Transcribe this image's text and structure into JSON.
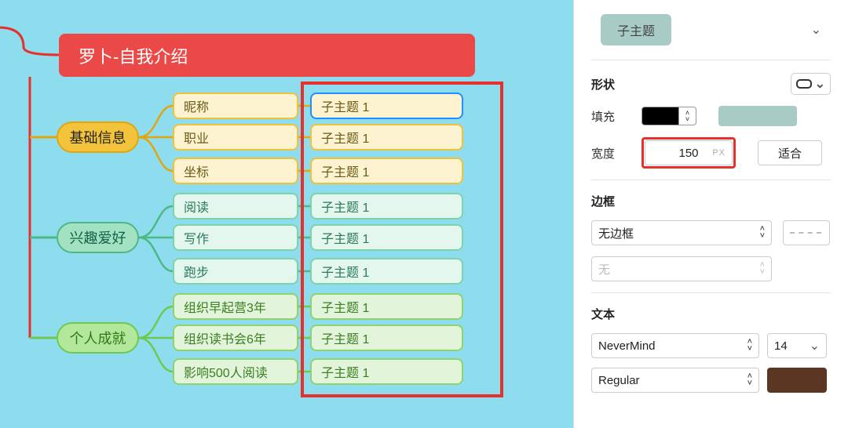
{
  "mindmap": {
    "root": "罗卜-自我介绍",
    "branches": [
      {
        "label": "基础信息",
        "subs": [
          "昵称",
          "职业",
          "坐标"
        ],
        "leaves": [
          "子主题 1",
          "子主题 1",
          "子主题 1"
        ]
      },
      {
        "label": "兴趣爱好",
        "subs": [
          "阅读",
          "写作",
          "跑步"
        ],
        "leaves": [
          "子主题 1",
          "子主题 1",
          "子主题 1"
        ]
      },
      {
        "label": "个人成就",
        "subs": [
          "组织早起营3年",
          "组织读书会6年",
          "影响500人阅读"
        ],
        "leaves": [
          "子主题 1",
          "子主题 1",
          "子主题 1"
        ]
      }
    ]
  },
  "panel": {
    "style_preview": "子主题",
    "shape": {
      "label": "形状"
    },
    "fill": {
      "label": "填充",
      "color_primary": "#000000",
      "color_fill": "#a8ccc5"
    },
    "width": {
      "label": "宽度",
      "value": "150",
      "unit": "PX",
      "fit": "适合"
    },
    "border": {
      "title": "边框",
      "style": "无边框",
      "color_label": "无"
    },
    "text": {
      "title": "文本",
      "font": "NeverMind",
      "size": "14",
      "weight": "Regular",
      "color": "#5a3623"
    }
  }
}
